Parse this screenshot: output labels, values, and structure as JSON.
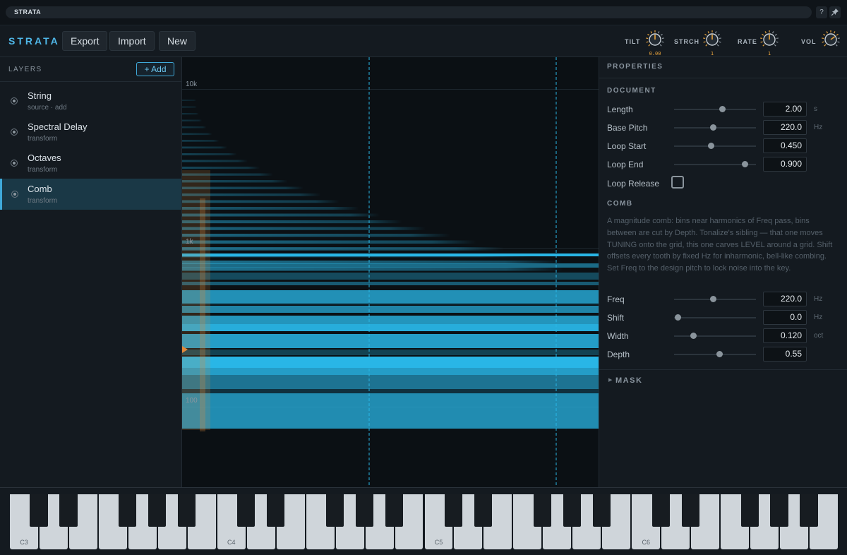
{
  "window": {
    "title": "STRATA",
    "help_label": "?",
    "pin_icon": "pin-icon"
  },
  "toolbar": {
    "logo": "STRATA",
    "buttons": [
      "Export",
      "Import",
      "New"
    ],
    "knobs": [
      {
        "label": "TILT",
        "value": "0.00",
        "level": 0.5
      },
      {
        "label": "STRCH",
        "value": "1",
        "level": 0.5
      },
      {
        "label": "RATE",
        "value": "1",
        "level": 0.5
      },
      {
        "label": "VOL",
        "value": "",
        "level": 0.7
      }
    ]
  },
  "layers": {
    "title": "LAYERS",
    "add_label": "+ Add",
    "items": [
      {
        "name": "String",
        "type": "source · add",
        "selected": false
      },
      {
        "name": "Spectral Delay",
        "type": "transform",
        "selected": false
      },
      {
        "name": "Octaves",
        "type": "transform",
        "selected": false
      },
      {
        "name": "Comb",
        "type": "transform",
        "selected": true
      }
    ]
  },
  "spectrogram": {
    "freq_labels": [
      "10k",
      "1k",
      "100"
    ],
    "accent_color": "#29b6e6",
    "marker_color": "#e08a3c"
  },
  "properties": {
    "title": "PROPERTIES",
    "document": {
      "title": "DOCUMENT",
      "params": [
        {
          "label": "Length",
          "value": "2.00",
          "unit": "s",
          "level": 0.59
        },
        {
          "label": "Base Pitch",
          "value": "220.0",
          "unit": "Hz",
          "level": 0.47
        },
        {
          "label": "Loop Start",
          "value": "0.450",
          "unit": "",
          "level": 0.45
        },
        {
          "label": "Loop End",
          "value": "0.900",
          "unit": "",
          "level": 0.86
        }
      ],
      "loop_release_label": "Loop Release",
      "loop_release_checked": false
    },
    "comb": {
      "title": "COMB",
      "description": "A magnitude comb: bins near harmonics of Freq pass, bins between are cut by Depth. Tonalize's sibling — that one moves TUNING onto the grid, this one carves LEVEL around a grid. Shift offsets every tooth by fixed Hz for inharmonic, bell-like combing. Set Freq to the design pitch to lock noise into the key.",
      "params": [
        {
          "label": "Freq",
          "value": "220.0",
          "unit": "Hz",
          "level": 0.47
        },
        {
          "label": "Shift",
          "value": "0.0",
          "unit": "Hz",
          "level": 0.04
        },
        {
          "label": "Width",
          "value": "0.120",
          "unit": "oct",
          "level": 0.23
        },
        {
          "label": "Depth",
          "value": "0.55",
          "unit": "",
          "level": 0.55
        }
      ]
    },
    "mask": {
      "title": "MASK",
      "collapsed": true
    }
  },
  "keyboard": {
    "white_key_count": 28,
    "octave_labels": [
      "C3",
      "C4",
      "C5",
      "C6"
    ]
  }
}
